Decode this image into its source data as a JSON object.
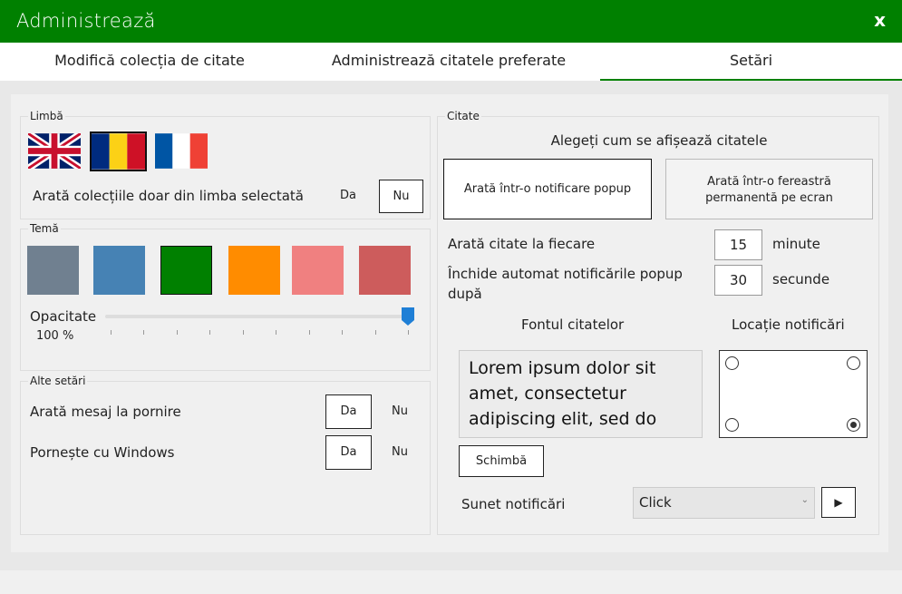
{
  "window": {
    "title": "Administrează",
    "close_label": "x"
  },
  "tabs": [
    {
      "label": "Modifică colecția de citate"
    },
    {
      "label": "Administrează citatele preferate"
    },
    {
      "label": "Setări",
      "active": true
    }
  ],
  "language": {
    "group_title": "Limbă",
    "flags": [
      {
        "name": "English"
      },
      {
        "name": "Română",
        "selected": true
      },
      {
        "name": "Français"
      }
    ],
    "filter_label": "Arată colecțiile doar din limba selectată",
    "yes": "Da",
    "no": "Nu"
  },
  "theme": {
    "group_title": "Temă",
    "swatches": [
      "#708090",
      "#4682b4",
      "#008000",
      "#ff8c00",
      "#f08080",
      "#cd5c5c"
    ],
    "opacity_label": "Opacitate",
    "opacity_value": "100 %",
    "opacity_fraction": 1.0
  },
  "other": {
    "group_title": "Alte setări",
    "startup_message_label": "Arată mesaj la pornire",
    "start_with_windows_label": "Pornește cu Windows",
    "yes": "Da",
    "no": "Nu"
  },
  "quotes": {
    "group_title": "Citate",
    "display_heading": "Alegeți cum se afișează citatele",
    "popup_option": "Arată într-o notificare popup",
    "window_option": "Arată într-o fereastră permanentă pe ecran",
    "show_every_label": "Arată citate la fiecare",
    "show_every_value": "15",
    "show_every_unit": "minute",
    "autoclose_label": "Închide automat notificările popup după",
    "autoclose_value": "30",
    "autoclose_unit": "secunde",
    "font_heading": "Fontul citatelor",
    "font_preview": "Lorem ipsum dolor sit amet, consectetur adipiscing elit, sed do",
    "change_button": "Schimbă",
    "location_heading": "Locație notificări",
    "sound_label": "Sunet notificări",
    "sound_value": "Click",
    "play_icon": "play-icon"
  }
}
